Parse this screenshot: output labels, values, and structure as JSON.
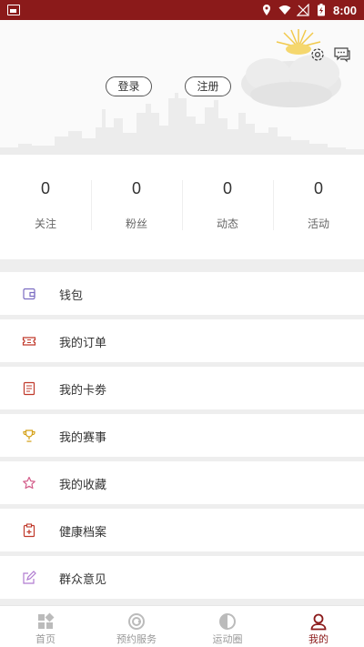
{
  "status_bar": {
    "time": "8:00"
  },
  "header": {
    "login_label": "登录",
    "register_label": "注册"
  },
  "stats": [
    {
      "value": "0",
      "label": "关注"
    },
    {
      "value": "0",
      "label": "粉丝"
    },
    {
      "value": "0",
      "label": "动态"
    },
    {
      "value": "0",
      "label": "活动"
    }
  ],
  "menu": [
    {
      "label": "钱包",
      "icon": "wallet-icon",
      "color": "#7b6cc2"
    },
    {
      "label": "我的订单",
      "icon": "ticket-icon",
      "color": "#c0392b"
    },
    {
      "label": "我的卡劵",
      "icon": "coupon-icon",
      "color": "#c0392b"
    },
    {
      "label": "我的赛事",
      "icon": "trophy-icon",
      "color": "#d4a017"
    },
    {
      "label": "我的收藏",
      "icon": "star-icon",
      "color": "#d35d8a"
    },
    {
      "label": "健康档案",
      "icon": "health-file-icon",
      "color": "#c0392b"
    },
    {
      "label": "群众意见",
      "icon": "feedback-edit-icon",
      "color": "#b07bd0"
    }
  ],
  "tabbar": [
    {
      "label": "首页",
      "icon": "home-grid-icon",
      "active": false
    },
    {
      "label": "预约服务",
      "icon": "booking-icon",
      "active": false
    },
    {
      "label": "运动圈",
      "icon": "circle-half-icon",
      "active": false
    },
    {
      "label": "我的",
      "icon": "profile-icon",
      "active": true
    }
  ],
  "colors": {
    "accent": "#8b1a1a",
    "background": "#eeeeee"
  }
}
